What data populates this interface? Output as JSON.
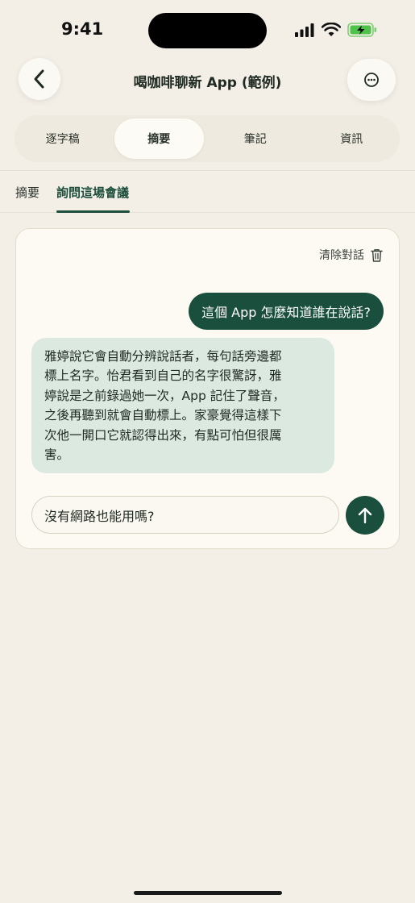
{
  "status_bar": {
    "time": "9:41"
  },
  "header": {
    "title": "喝咖啡聊新 App (範例)"
  },
  "segments": [
    {
      "label": "逐字稿",
      "active": false
    },
    {
      "label": "摘要",
      "active": true
    },
    {
      "label": "筆記",
      "active": false
    },
    {
      "label": "資訊",
      "active": false
    }
  ],
  "subtabs": [
    {
      "label": "摘要",
      "active": false
    },
    {
      "label": "詢問這場會議",
      "active": true
    }
  ],
  "chat": {
    "clear_label": "清除對話",
    "messages": [
      {
        "role": "user",
        "text": "這個 App 怎麼知道誰在說話?"
      },
      {
        "role": "assistant",
        "lines": [
          "雅婷說它會自動分辨說話者，每句話旁邊都",
          "標上名字。怡君看到自己的名字很驚訝，雅",
          "婷說是之前錄過她一次，App 記住了聲音，",
          "之後再聽到就會自動標上。家豪覺得這樣下",
          "次他一開口它就認得出來，有點可怕但很厲",
          "害。"
        ]
      }
    ],
    "input_value": "沒有網路也能用嗎?"
  },
  "icons": {
    "back": "chevron-left-icon",
    "more": "ellipsis-circle-icon",
    "clear": "trash-icon",
    "send": "arrow-up-icon"
  },
  "colors": {
    "accent": "#1b4f3d",
    "background": "#f3efe7",
    "bot_bubble": "#dce9e1"
  }
}
